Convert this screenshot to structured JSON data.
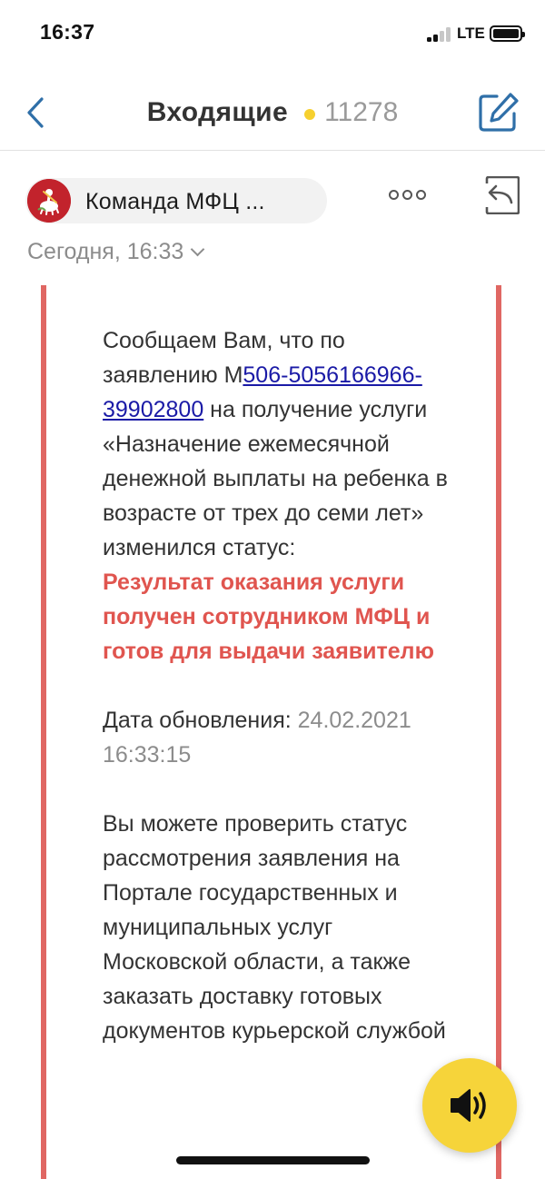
{
  "status_bar": {
    "time": "16:37",
    "network": "LTE"
  },
  "nav": {
    "title": "Входящие",
    "unread_count": "11278"
  },
  "message": {
    "sender": "Команда МФЦ ...",
    "date": "Сегодня, 16:33",
    "body": {
      "intro_before_link": "Сообщаем Вам, что по заявлению М",
      "application_link": "506-5056166966-39902800",
      "intro_after_link": " на получение услуги «Назначение ежемесячной денежной выплаты на ребенка в возрасте от трех до семи лет» изменился статус:",
      "status_result": "Результат оказания услуги получен сотрудником МФЦ и готов для выдачи заявителю",
      "update_label": "Дата обновления: ",
      "update_value": "24.02.2021 16:33:15",
      "portal_text": "Вы можете проверить статус рассмотрения заявления на Портале государственных и муниципальных услуг Московской области, а также заказать доставку готовых документов курьерской службой"
    }
  },
  "colors": {
    "accent_blue": "#2f6fa8",
    "frame_red": "#e06763",
    "status_red": "#e0554f",
    "fab_yellow": "#f6d43a",
    "unread_dot": "#f6d02f"
  },
  "icons": {
    "back": "chevron-left-icon",
    "compose": "compose-icon",
    "more": "more-dots-icon",
    "reply": "reply-icon",
    "audio": "speaker-icon",
    "date_toggle": "chevron-down-icon",
    "avatar": "moscow-emblem-icon"
  }
}
